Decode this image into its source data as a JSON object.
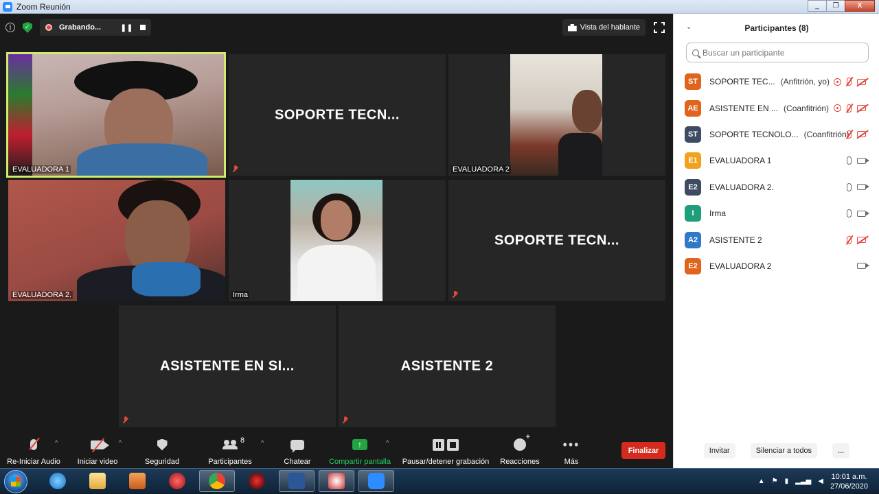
{
  "window": {
    "title": "Zoom Reunión",
    "controls": [
      "_",
      "❐",
      "X"
    ]
  },
  "topbar": {
    "recording_label": "Grabando...",
    "speaker_view_label": "Vista del hablante"
  },
  "tiles": [
    {
      "name": "EVALUADORA 1",
      "video": true,
      "active": true
    },
    {
      "name": "SOPORTE TECN...",
      "video": false,
      "muted": true
    },
    {
      "name": "EVALUADORA 2",
      "video": true
    },
    {
      "name": "EVALUADORA 2.",
      "video": true
    },
    {
      "name": "Irma",
      "video": true
    },
    {
      "name": "SOPORTE TECN...",
      "video": false,
      "muted": true
    },
    {
      "name": "ASISTENTE EN SI...",
      "video": false,
      "muted": true
    },
    {
      "name": "ASISTENTE 2",
      "video": false,
      "muted": true
    }
  ],
  "toolbar": {
    "audio_label": "Re-Iniciar Audio",
    "video_label": "Iniciar video",
    "security_label": "Seguridad",
    "participants_label": "Participantes",
    "participants_count": "8",
    "chat_label": "Chatear",
    "share_label": "Compartir pantalla",
    "record_label": "Pausar/detener grabación",
    "reactions_label": "Reacciones",
    "more_label": "Más",
    "end_label": "Finalizar"
  },
  "panel": {
    "title": "Participantes (8)",
    "search_placeholder": "Buscar un participante",
    "participants": [
      {
        "initials": "ST",
        "color": "#e0641b",
        "name": "SOPORTE TEC...",
        "role": "(Anfitrión, yo)",
        "rec": true,
        "mic": "off",
        "cam": "off"
      },
      {
        "initials": "AE",
        "color": "#e0641b",
        "name": "ASISTENTE EN ...",
        "role": "(Coanfitrión)",
        "rec": true,
        "mic": "off",
        "cam": "off"
      },
      {
        "initials": "ST",
        "color": "#3d4b63",
        "name": "SOPORTE TECNOLO...",
        "role": "(Coanfitrión)",
        "rec": false,
        "mic": "off",
        "cam": "off"
      },
      {
        "initials": "E1",
        "color": "#f0a21f",
        "name": "EVALUADORA 1",
        "role": "",
        "rec": false,
        "mic": "on",
        "cam": "on"
      },
      {
        "initials": "E2",
        "color": "#3d4b63",
        "name": "EVALUADORA 2.",
        "role": "",
        "rec": false,
        "mic": "on",
        "cam": "on"
      },
      {
        "initials": "I",
        "color": "#1e9e7a",
        "name": "Irma",
        "role": "",
        "rec": false,
        "mic": "on",
        "cam": "on"
      },
      {
        "initials": "A2",
        "color": "#2f79c7",
        "name": "ASISTENTE 2",
        "role": "",
        "rec": false,
        "mic": "off",
        "cam": "off"
      },
      {
        "initials": "E2",
        "color": "#e0641b",
        "name": "EVALUADORA 2",
        "role": "",
        "rec": false,
        "mic": "none",
        "cam": "on"
      }
    ],
    "invite_label": "Invitar",
    "mute_all_label": "Silenciar a todos",
    "more_label": "..."
  },
  "taskbar": {
    "time": "10:01 a.m.",
    "date": "27/06/2020"
  }
}
